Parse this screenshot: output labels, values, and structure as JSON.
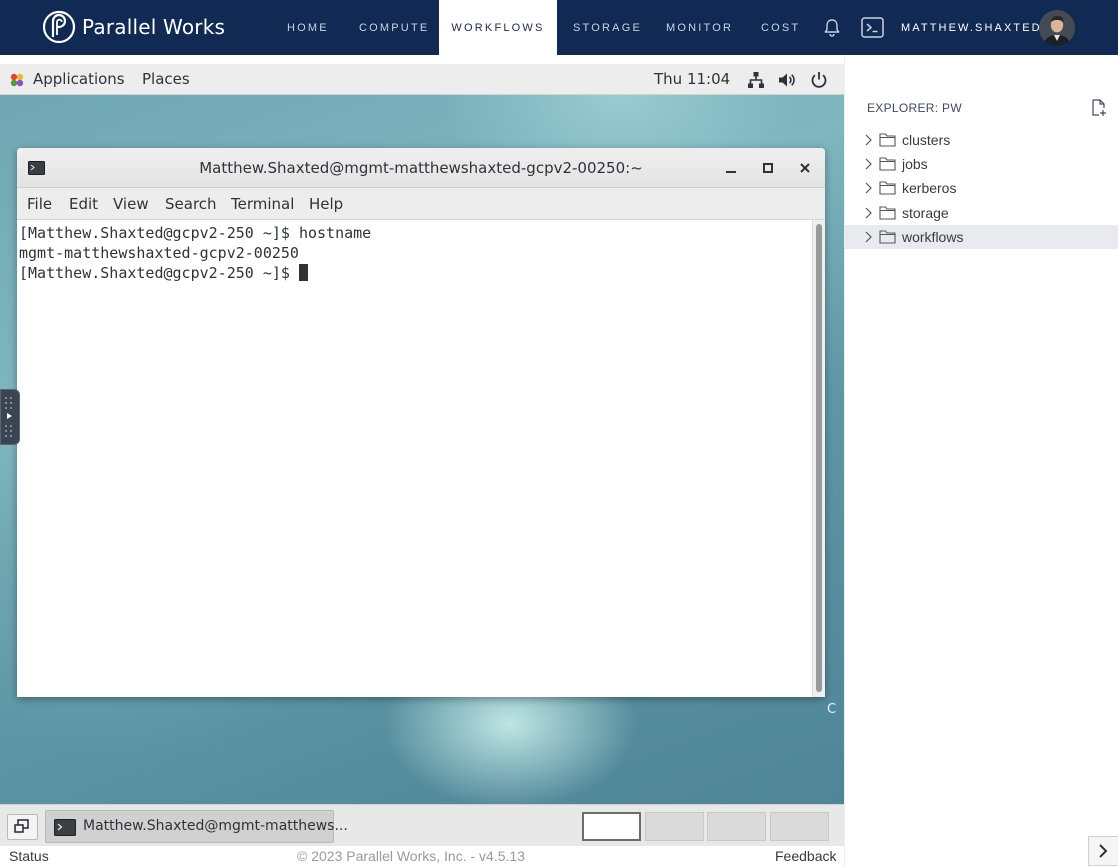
{
  "nav": {
    "brand": "Parallel Works",
    "links": [
      "HOME",
      "COMPUTE",
      "WORKFLOWS",
      "STORAGE",
      "MONITOR",
      "COST"
    ],
    "active": "WORKFLOWS",
    "user": "MATTHEW.SHAXTED",
    "icons": [
      "parallel-works-logo",
      "bell-icon",
      "terminal-icon",
      "avatar"
    ]
  },
  "desktop": {
    "topbar": {
      "applications": "Applications",
      "places": "Places",
      "clock": "Thu 11:04",
      "icons": [
        "network-icon",
        "volume-icon",
        "power-icon"
      ]
    },
    "terminal": {
      "title": "Matthew.Shaxted@mgmt-matthewshaxted-gcpv2-00250:~",
      "menu": [
        "File",
        "Edit",
        "View",
        "Search",
        "Terminal",
        "Help"
      ],
      "lines": [
        "[Matthew.Shaxted@gcpv2-250 ~]$ hostname",
        "mgmt-matthewshaxted-gcpv2-00250",
        "[Matthew.Shaxted@gcpv2-250 ~]$ "
      ]
    },
    "corner_char": "C",
    "taskbar": {
      "task_label": "Matthew.Shaxted@mgmt-matthews...",
      "workspaces": 4,
      "active_workspace": 1
    }
  },
  "statusbar": {
    "status": "Status",
    "copyright": "© 2023 Parallel Works, Inc. - v4.5.13",
    "feedback": "Feedback"
  },
  "explorer": {
    "title": "EXPLORER: PW",
    "items": [
      {
        "label": "clusters",
        "selected": false
      },
      {
        "label": "jobs",
        "selected": false
      },
      {
        "label": "kerberos",
        "selected": false
      },
      {
        "label": "storage",
        "selected": false
      },
      {
        "label": "workflows",
        "selected": true
      }
    ]
  }
}
